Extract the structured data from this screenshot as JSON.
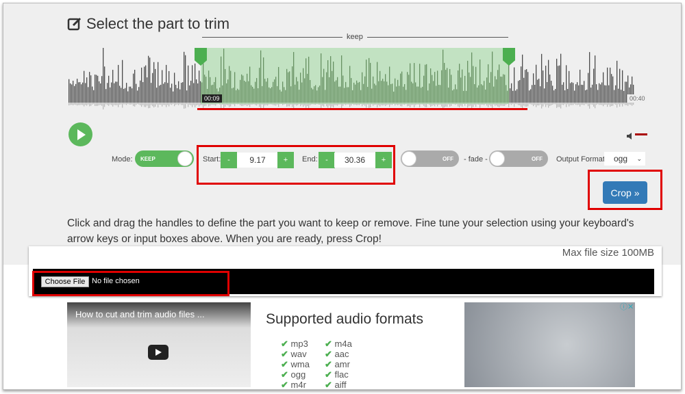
{
  "header": {
    "title": "Select the part to trim",
    "icon": "edit-icon",
    "keep_label": "keep"
  },
  "waveform": {
    "start_time": "00:09",
    "end_time": "00:40",
    "selection_color": "#a8dca8"
  },
  "controls": {
    "mode_label": "Mode:",
    "mode_value": "KEEP",
    "start_label": "Start:",
    "start_value": "9.17",
    "end_label": "End:",
    "end_value": "30.36",
    "minus": "-",
    "plus": "+",
    "fade_in": "OFF",
    "fade_label": "- fade -",
    "fade_out": "OFF",
    "output_format_label": "Output Format",
    "output_format": "ogg",
    "crop_label": "Crop »"
  },
  "instructions": "Click and drag the handles to define the part you want to keep or remove. Fine tune your selection using your keyboard's arrow keys or input boxes above. When you are ready, press Crop!",
  "upload": {
    "max_size": "Max file size 100MB",
    "choose_file": "Choose File",
    "no_file": "No file chosen"
  },
  "video": {
    "title": "How to cut and trim audio files ..."
  },
  "formats": {
    "title": "Supported audio formats",
    "col1": [
      "mp3",
      "wav",
      "wma",
      "ogg",
      "m4r"
    ],
    "col2": [
      "m4a",
      "aac",
      "amr",
      "flac",
      "aiff"
    ]
  },
  "colors": {
    "accent": "#5cb85c",
    "highlight": "#e00000",
    "crop": "#337ab7"
  }
}
